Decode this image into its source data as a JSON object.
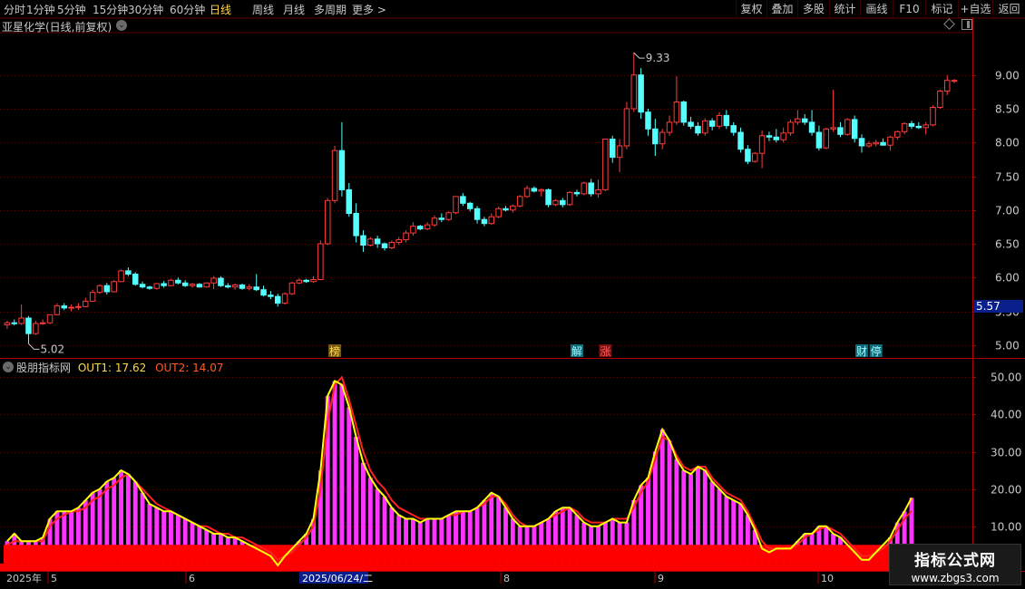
{
  "toolbar": {
    "periods": [
      "分时",
      "1分钟",
      "5分钟",
      "15分钟",
      "30分钟",
      "60分钟",
      "日线",
      "周线",
      "月线",
      "多周期",
      "更多 >"
    ],
    "active_period": "日线",
    "right_buttons": [
      "复权",
      "叠加",
      "多股",
      "统计",
      "画线",
      "F10",
      "标记",
      "+自选",
      "返回"
    ]
  },
  "stock": {
    "title": "亚星化学(日线,前复权)"
  },
  "indicator": {
    "name": "股朋指标网",
    "out1": "OUT1: 17.62",
    "out2": "OUT2: 14.07"
  },
  "watermark": {
    "line1": "指标公式网",
    "line2": "www.zbgs3.com"
  },
  "colors": {
    "up": "#ff3c3c",
    "down": "#54ffff",
    "out1": "#ffff00",
    "out2": "#ff2020",
    "bar": "#ff33ff",
    "base": "#ff0000",
    "grid": "#5a0000"
  },
  "chart_data": [
    {
      "type": "candlestick",
      "title": "亚星化学(日线,前复权)",
      "y_ticks": [
        "5.00",
        "5.50",
        "6.00",
        "6.50",
        "7.00",
        "7.50",
        "8.00",
        "8.50",
        "9.00"
      ],
      "ylim": [
        4.85,
        9.6
      ],
      "current_price": "5.57",
      "high_label": "9.33",
      "low_label": "5.02",
      "x_tick_labels": [
        "2025年",
        "5",
        "6",
        "2025/06/24/二",
        "8",
        "9",
        "10"
      ],
      "markers": [
        {
          "text": "榜",
          "index": 46
        },
        {
          "text": "解",
          "index": 80
        },
        {
          "text": "涨",
          "index": 84
        },
        {
          "text": "财",
          "index": 120
        },
        {
          "text": "停",
          "index": 122
        }
      ],
      "candles": [
        [
          5.3,
          5.36,
          5.24,
          5.33
        ],
        [
          5.33,
          5.38,
          5.29,
          5.32
        ],
        [
          5.32,
          5.6,
          5.3,
          5.4
        ],
        [
          5.4,
          5.43,
          5.02,
          5.17
        ],
        [
          5.17,
          5.36,
          5.15,
          5.32
        ],
        [
          5.32,
          5.38,
          5.3,
          5.33
        ],
        [
          5.33,
          5.45,
          5.31,
          5.45
        ],
        [
          5.45,
          5.62,
          5.44,
          5.58
        ],
        [
          5.58,
          5.62,
          5.52,
          5.55
        ],
        [
          5.55,
          5.6,
          5.5,
          5.56
        ],
        [
          5.56,
          5.62,
          5.52,
          5.57
        ],
        [
          5.57,
          5.7,
          5.56,
          5.65
        ],
        [
          5.65,
          5.82,
          5.64,
          5.78
        ],
        [
          5.78,
          5.9,
          5.76,
          5.88
        ],
        [
          5.88,
          5.92,
          5.75,
          5.79
        ],
        [
          5.79,
          5.96,
          5.78,
          5.94
        ],
        [
          5.94,
          6.12,
          5.93,
          6.1
        ],
        [
          6.1,
          6.15,
          6.02,
          6.05
        ],
        [
          6.05,
          6.08,
          5.88,
          5.9
        ],
        [
          5.9,
          5.94,
          5.84,
          5.86
        ],
        [
          5.86,
          5.88,
          5.82,
          5.84
        ],
        [
          5.84,
          5.92,
          5.82,
          5.91
        ],
        [
          5.91,
          5.95,
          5.85,
          5.88
        ],
        [
          5.88,
          5.98,
          5.87,
          5.96
        ],
        [
          5.96,
          6.0,
          5.9,
          5.92
        ],
        [
          5.92,
          5.96,
          5.86,
          5.88
        ],
        [
          5.88,
          5.92,
          5.85,
          5.9
        ],
        [
          5.9,
          5.92,
          5.85,
          5.86
        ],
        [
          5.86,
          5.93,
          5.85,
          5.92
        ],
        [
          5.92,
          6.02,
          5.83,
          5.99
        ],
        [
          5.99,
          6.02,
          5.86,
          5.88
        ],
        [
          5.88,
          5.92,
          5.84,
          5.86
        ],
        [
          5.86,
          5.91,
          5.82,
          5.89
        ],
        [
          5.89,
          5.91,
          5.82,
          5.84
        ],
        [
          5.84,
          5.9,
          5.81,
          5.86
        ],
        [
          5.86,
          6.05,
          5.8,
          5.82
        ],
        [
          5.82,
          5.88,
          5.72,
          5.74
        ],
        [
          5.74,
          5.8,
          5.68,
          5.72
        ],
        [
          5.72,
          5.76,
          5.57,
          5.62
        ],
        [
          5.62,
          5.78,
          5.6,
          5.76
        ],
        [
          5.76,
          5.94,
          5.74,
          5.92
        ],
        [
          5.92,
          5.99,
          5.9,
          5.96
        ],
        [
          5.96,
          5.98,
          5.92,
          5.94
        ],
        [
          5.94,
          6.02,
          5.92,
          5.97
        ],
        [
          5.97,
          6.55,
          5.96,
          6.5
        ],
        [
          6.5,
          7.18,
          6.48,
          7.14
        ],
        [
          7.14,
          7.95,
          7.1,
          7.88
        ],
        [
          7.88,
          8.3,
          7.2,
          7.3
        ],
        [
          7.3,
          7.4,
          6.9,
          6.95
        ],
        [
          6.95,
          7.1,
          6.52,
          6.62
        ],
        [
          6.62,
          6.7,
          6.38,
          6.48
        ],
        [
          6.48,
          6.6,
          6.46,
          6.57
        ],
        [
          6.57,
          6.62,
          6.44,
          6.5
        ],
        [
          6.5,
          6.52,
          6.4,
          6.44
        ],
        [
          6.44,
          6.55,
          6.42,
          6.52
        ],
        [
          6.52,
          6.6,
          6.48,
          6.56
        ],
        [
          6.56,
          6.7,
          6.52,
          6.66
        ],
        [
          6.66,
          6.82,
          6.62,
          6.76
        ],
        [
          6.76,
          6.78,
          6.7,
          6.72
        ],
        [
          6.72,
          6.82,
          6.7,
          6.78
        ],
        [
          6.78,
          6.92,
          6.75,
          6.88
        ],
        [
          6.88,
          6.95,
          6.82,
          6.86
        ],
        [
          6.86,
          6.98,
          6.84,
          6.96
        ],
        [
          6.96,
          7.2,
          6.94,
          7.2
        ],
        [
          7.2,
          7.25,
          7.06,
          7.1
        ],
        [
          7.1,
          7.12,
          6.98,
          7.02
        ],
        [
          7.02,
          7.06,
          6.8,
          6.86
        ],
        [
          6.86,
          6.9,
          6.76,
          6.8
        ],
        [
          6.8,
          6.95,
          6.78,
          6.9
        ],
        [
          6.9,
          7.05,
          6.88,
          7.02
        ],
        [
          7.02,
          7.06,
          6.98,
          7.0
        ],
        [
          7.0,
          7.08,
          6.96,
          7.06
        ],
        [
          7.06,
          7.22,
          7.04,
          7.2
        ],
        [
          7.2,
          7.36,
          7.18,
          7.32
        ],
        [
          7.32,
          7.35,
          7.26,
          7.28
        ],
        [
          7.28,
          7.32,
          7.2,
          7.3
        ],
        [
          7.3,
          7.32,
          7.04,
          7.08
        ],
        [
          7.08,
          7.16,
          7.06,
          7.14
        ],
        [
          7.14,
          7.18,
          7.04,
          7.08
        ],
        [
          7.08,
          7.28,
          7.06,
          7.26
        ],
        [
          7.26,
          7.3,
          7.2,
          7.24
        ],
        [
          7.24,
          7.42,
          7.22,
          7.4
        ],
        [
          7.4,
          7.46,
          7.2,
          7.24
        ],
        [
          7.24,
          7.45,
          7.18,
          7.3
        ],
        [
          7.3,
          8.05,
          7.28,
          8.05
        ],
        [
          8.05,
          8.1,
          7.7,
          7.78
        ],
        [
          7.78,
          8.05,
          7.56,
          7.95
        ],
        [
          7.95,
          8.6,
          7.9,
          8.5
        ],
        [
          8.5,
          9.33,
          8.45,
          9.0
        ],
        [
          9.0,
          9.1,
          8.35,
          8.45
        ],
        [
          8.45,
          8.5,
          8.1,
          8.2
        ],
        [
          8.2,
          8.35,
          7.8,
          7.98
        ],
        [
          7.98,
          8.2,
          7.9,
          8.15
        ],
        [
          8.15,
          8.4,
          8.1,
          8.3
        ],
        [
          8.3,
          8.98,
          8.26,
          8.6
        ],
        [
          8.6,
          8.62,
          8.25,
          8.3
        ],
        [
          8.3,
          8.38,
          8.2,
          8.24
        ],
        [
          8.24,
          8.3,
          8.1,
          8.14
        ],
        [
          8.14,
          8.36,
          8.1,
          8.32
        ],
        [
          8.32,
          8.36,
          8.18,
          8.24
        ],
        [
          8.24,
          8.45,
          8.2,
          8.4
        ],
        [
          8.4,
          8.48,
          8.2,
          8.25
        ],
        [
          8.25,
          8.3,
          8.1,
          8.15
        ],
        [
          8.15,
          8.22,
          7.85,
          7.9
        ],
        [
          7.9,
          7.96,
          7.68,
          7.72
        ],
        [
          7.72,
          7.86,
          7.7,
          7.84
        ],
        [
          7.84,
          8.18,
          7.62,
          8.1
        ],
        [
          8.1,
          8.16,
          8.02,
          8.08
        ],
        [
          8.08,
          8.2,
          8.0,
          8.04
        ],
        [
          8.04,
          8.22,
          8.0,
          8.14
        ],
        [
          8.14,
          8.34,
          8.1,
          8.3
        ],
        [
          8.3,
          8.48,
          8.26,
          8.35
        ],
        [
          8.35,
          8.42,
          8.26,
          8.3
        ],
        [
          8.3,
          8.48,
          8.1,
          8.15
        ],
        [
          8.15,
          8.25,
          7.88,
          7.92
        ],
        [
          7.92,
          8.22,
          7.9,
          8.2
        ],
        [
          8.2,
          8.78,
          8.16,
          8.22
        ],
        [
          8.22,
          8.3,
          8.08,
          8.12
        ],
        [
          8.12,
          8.36,
          8.1,
          8.34
        ],
        [
          8.34,
          8.4,
          8.0,
          8.06
        ],
        [
          8.06,
          8.12,
          7.85,
          7.95
        ],
        [
          7.95,
          8.02,
          7.92,
          7.98
        ],
        [
          7.98,
          8.04,
          7.94,
          8.0
        ],
        [
          8.0,
          8.06,
          7.96,
          7.96
        ],
        [
          7.96,
          8.1,
          7.88,
          8.08
        ],
        [
          8.08,
          8.18,
          8.04,
          8.16
        ],
        [
          8.16,
          8.3,
          8.12,
          8.28
        ],
        [
          8.28,
          8.32,
          8.2,
          8.24
        ],
        [
          8.24,
          8.3,
          8.2,
          8.22
        ],
        [
          8.22,
          8.3,
          8.12,
          8.26
        ],
        [
          8.26,
          8.55,
          8.24,
          8.52
        ],
        [
          8.52,
          8.78,
          8.5,
          8.76
        ],
        [
          8.76,
          9.0,
          8.7,
          8.92
        ],
        [
          8.92,
          8.94,
          8.88,
          8.92
        ]
      ]
    },
    {
      "type": "bar",
      "title": "股朋指标网",
      "y_ticks": [
        "10.00",
        "20.00",
        "30.00",
        "40.00",
        "50.00"
      ],
      "ylim": [
        -1.5,
        53
      ],
      "base_value": 5,
      "series": [
        {
          "name": "OUT1",
          "values": [
            6,
            8,
            6,
            6,
            6,
            7,
            12,
            14,
            14,
            14,
            15,
            17,
            19,
            20,
            22,
            23,
            25,
            24,
            22,
            19,
            16,
            15,
            14,
            14,
            13,
            12,
            11,
            10,
            9,
            8,
            8,
            7,
            7,
            6,
            5,
            4,
            3,
            2,
            -0.5,
            2,
            4,
            6,
            8,
            12,
            25,
            45,
            49,
            48,
            42,
            34,
            27,
            23,
            20,
            18,
            15,
            13,
            12,
            12,
            11,
            12,
            12,
            12,
            13,
            14,
            14,
            14,
            15,
            17,
            19,
            18,
            15,
            12,
            10,
            10,
            10,
            11,
            12,
            14,
            15,
            15,
            13,
            11,
            10,
            10,
            11,
            12,
            11,
            11,
            17,
            21,
            23,
            30,
            36,
            33,
            28,
            25,
            24,
            26,
            25,
            22,
            20,
            18,
            17,
            16,
            13,
            9,
            4,
            3,
            4,
            4,
            4,
            6,
            8,
            8,
            10,
            10,
            8,
            7,
            5,
            3,
            1,
            1,
            3,
            5,
            7,
            11,
            14,
            17.62
          ]
        },
        {
          "name": "OUT2",
          "values": [
            5,
            6,
            6,
            6,
            6,
            6,
            10,
            12,
            13,
            14,
            14,
            15,
            17,
            18,
            20,
            21,
            23,
            24,
            22,
            20,
            18,
            16,
            15,
            14,
            13,
            12,
            11,
            10,
            10,
            9,
            8,
            8,
            7,
            7,
            6,
            5,
            4,
            3,
            1,
            2,
            3,
            5,
            7,
            10,
            20,
            38,
            48,
            50,
            44,
            37,
            30,
            25,
            22,
            20,
            17,
            15,
            14,
            13,
            12,
            12,
            12,
            12,
            13,
            13,
            14,
            14,
            15,
            16,
            18,
            18,
            16,
            13,
            11,
            10,
            10,
            11,
            12,
            13,
            14,
            15,
            14,
            12,
            11,
            11,
            11,
            12,
            12,
            12,
            15,
            19,
            22,
            28,
            34,
            33,
            29,
            26,
            25,
            26,
            26,
            23,
            21,
            19,
            18,
            17,
            14,
            10,
            6,
            4,
            4,
            4,
            4,
            5,
            7,
            8,
            9,
            10,
            9,
            8,
            6,
            4,
            2,
            2,
            3,
            4,
            6,
            9,
            12,
            14.07
          ]
        }
      ]
    }
  ]
}
